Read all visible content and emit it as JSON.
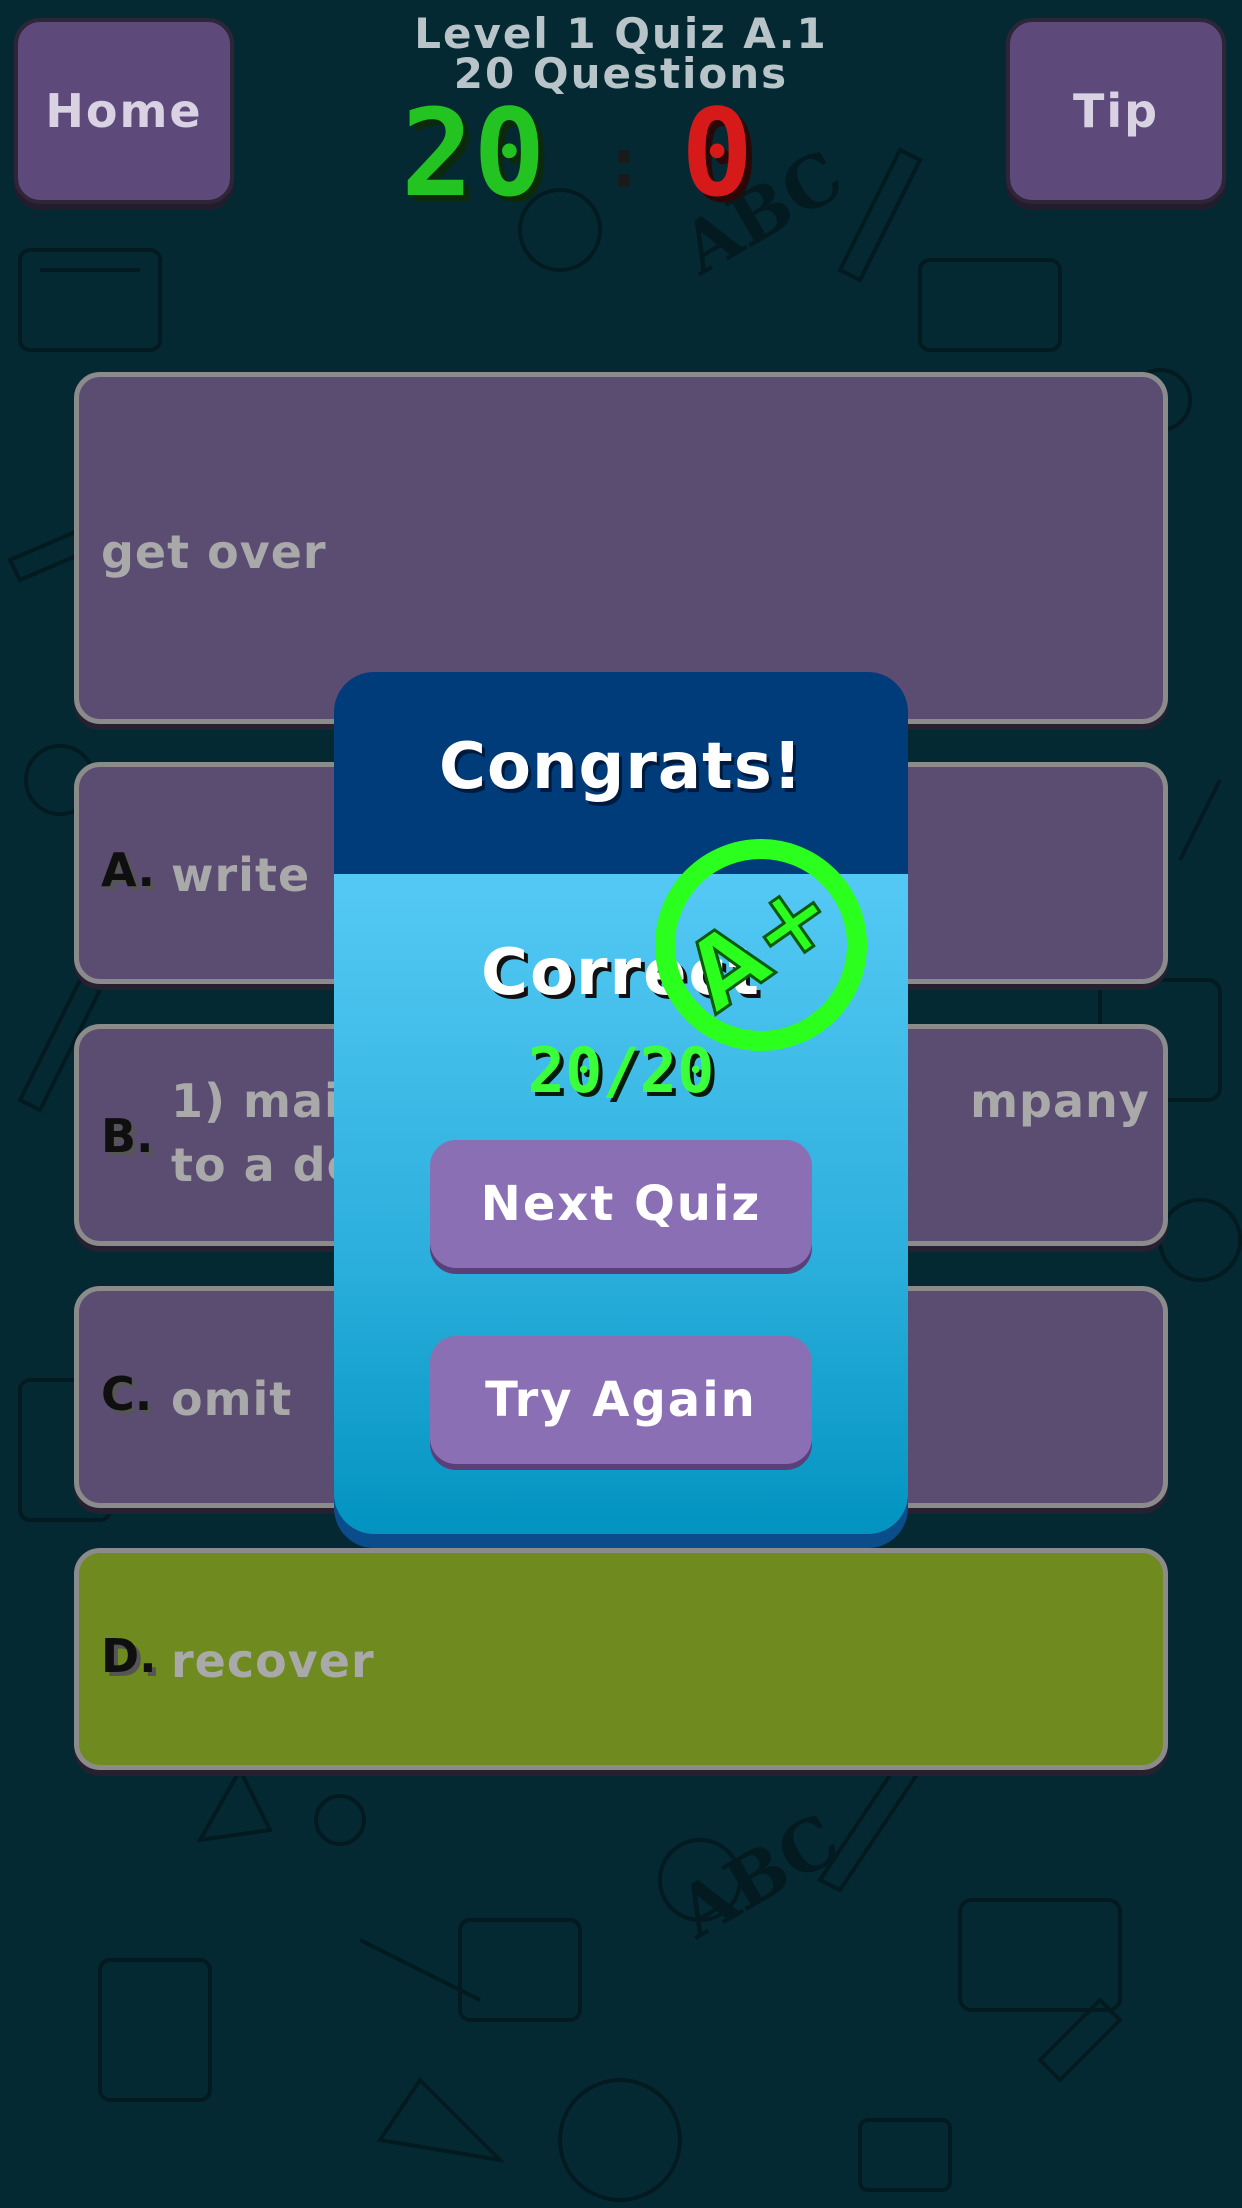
{
  "header": {
    "home_label": "Home",
    "tip_label": "Tip",
    "title_line1": "Level 1 Quiz A.1",
    "title_line2": "20 Questions",
    "score_correct": "20",
    "score_separator": ":",
    "score_wrong": "0"
  },
  "question": {
    "text": "get over"
  },
  "options": [
    {
      "letter": "A.",
      "text": "write"
    },
    {
      "letter": "B.",
      "text": "1) mail                                    mpany to a depa"
    },
    {
      "letter": "C.",
      "text": "omit"
    },
    {
      "letter": "D.",
      "text": "recover"
    }
  ],
  "dialog": {
    "title": "Congrats!",
    "correct_label": "Correct",
    "correct_score": "20/20",
    "next_label": "Next Quiz",
    "retry_label": "Try Again",
    "grade": "A+"
  },
  "colors": {
    "background": "#0b5c70",
    "card": "#5b4c72",
    "selected_option": "#6f8a1f",
    "dialog_header": "#003b7a",
    "dialog_button": "#8b6fb5",
    "score_correct": "#23c322",
    "score_wrong": "#d61a1a",
    "grade_badge": "#2bff1d"
  },
  "icons": {
    "background": "school-doodle-pattern",
    "grade_badge": "a-plus-stamp-icon"
  }
}
